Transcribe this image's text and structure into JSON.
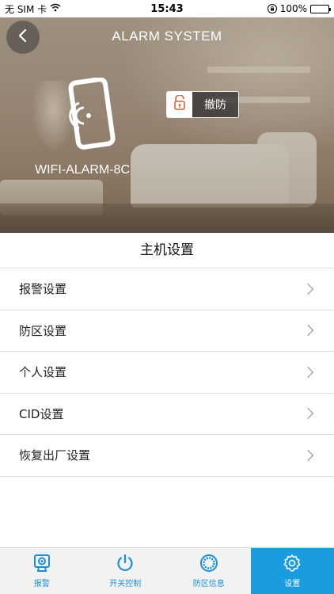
{
  "status_bar": {
    "carrier": "无 SIM 卡",
    "time": "15:43",
    "battery": "100%"
  },
  "header": {
    "title": "ALARM SYSTEM",
    "device_name": "WIFI-ALARM-8C",
    "disarm_label": "撤防"
  },
  "settings": {
    "title": "主机设置",
    "items": [
      {
        "label": "报警设置"
      },
      {
        "label": "防区设置"
      },
      {
        "label": "个人设置"
      },
      {
        "label": "CID设置"
      },
      {
        "label": "恢复出厂设置"
      }
    ]
  },
  "tabbar": {
    "tabs": [
      {
        "label": "报警",
        "icon": "camera-icon"
      },
      {
        "label": "开关控制",
        "icon": "power-icon"
      },
      {
        "label": "防区信息",
        "icon": "zone-ring-icon"
      },
      {
        "label": "设置",
        "icon": "gear-icon",
        "active": true
      }
    ]
  },
  "colors": {
    "accent": "#1a9ce0",
    "lock_icon": "#e0603a"
  }
}
